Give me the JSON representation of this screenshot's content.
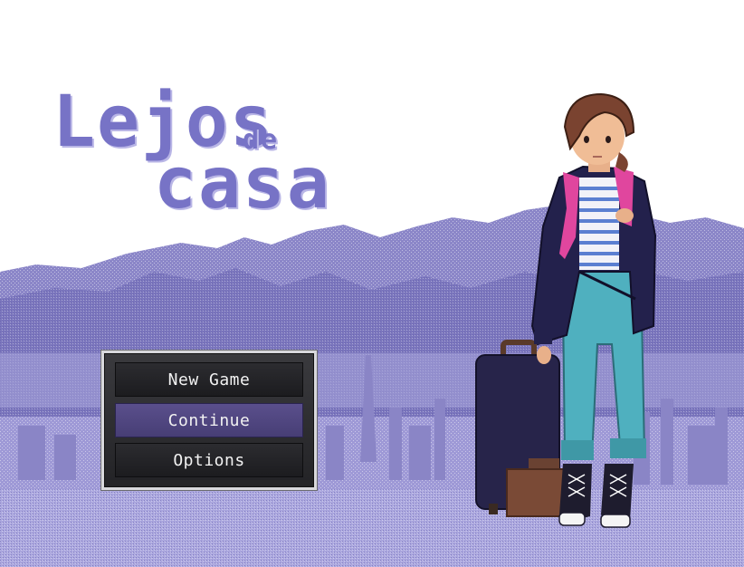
{
  "game": {
    "title_line1": "Lejos",
    "title_small": "de",
    "title_line2": "casa"
  },
  "menu": {
    "items": [
      {
        "label": "New Game",
        "selected": false
      },
      {
        "label": "Continue",
        "selected": true
      },
      {
        "label": "Options",
        "selected": false
      }
    ]
  },
  "colors": {
    "title": "#7773c6",
    "sky": "#ffffff",
    "mountains": "#8b86c8",
    "city": "#9e99d6",
    "menu_panel": "#2b2b2f",
    "menu_selected": "#4f4682"
  }
}
